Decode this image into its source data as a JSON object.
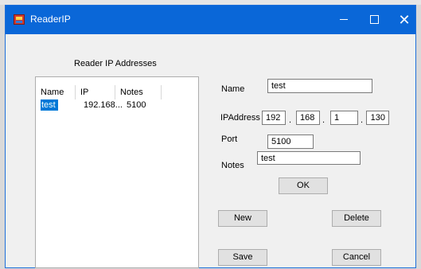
{
  "window": {
    "title": "ReaderIP"
  },
  "list": {
    "title": "Reader IP Addresses",
    "columns": [
      "Name",
      "IP",
      "Notes"
    ],
    "rows": [
      {
        "name": "test",
        "ip": "192.168...",
        "notes": "5100"
      }
    ]
  },
  "form": {
    "name_label": "Name",
    "name_value": "test",
    "ip_label": "IPAddress",
    "ip_octets": [
      "192",
      "168",
      "1",
      "130"
    ],
    "port_label": "Port",
    "port_value": "5100",
    "notes_label": "Notes",
    "notes_value": "test",
    "ok_label": "OK",
    "new_label": "New",
    "delete_label": "Delete",
    "save_label": "Save",
    "cancel_label": "Cancel"
  },
  "colors": {
    "titlebar": "#0a67d8",
    "selection": "#0078d7"
  }
}
